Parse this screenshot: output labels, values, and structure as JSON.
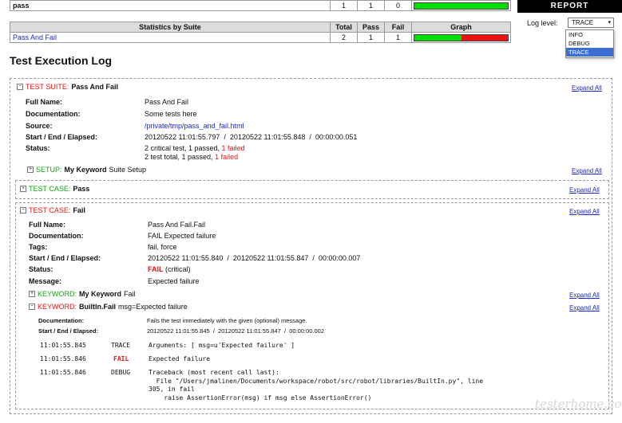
{
  "top_row": {
    "name": "pass",
    "total": "1",
    "pass": "1",
    "fail": "0",
    "pass_fraction": 1.0
  },
  "suite_stats": {
    "headers": [
      "Statistics by Suite",
      "Total",
      "Pass",
      "Fail",
      "Graph"
    ],
    "row": {
      "name": "Pass And Fail",
      "total": "2",
      "pass": "1",
      "fail": "1",
      "pass_fraction": 0.5
    }
  },
  "report": {
    "title": "REPORT",
    "log_level_label": "Log level:",
    "selected": "TRACE",
    "options": [
      "INFO",
      "DEBUG",
      "TRACE"
    ]
  },
  "log_title": "Test Execution Log",
  "suite": {
    "prefix": "TEST SUITE:",
    "name": "Pass And Fail",
    "expand": "Expand All",
    "labels": [
      "Full Name:",
      "Documentation:",
      "Source:",
      "Start / End / Elapsed:",
      "Status:"
    ],
    "full_name": "Pass And Fail",
    "documentation": "Some tests here",
    "source": "/private/tmp/pass_and_fail.html",
    "times": "20120522 11:01:55.797  /  20120522 11:01:55.848  /  00:00:00.051",
    "status1_prefix": "2 critical test, 1 passed, ",
    "status1_failed": "1 failed",
    "status2_prefix": "2 test total, 1 passed, ",
    "status2_failed": "1 failed",
    "setup": {
      "prefix": "SETUP:",
      "name": "My Keyword",
      "rest": "Suite Setup",
      "expand": "Expand All"
    }
  },
  "case_pass": {
    "prefix": "TEST CASE:",
    "name": "Pass",
    "expand": "Expand All"
  },
  "case_fail": {
    "prefix": "TEST CASE:",
    "name": "Fail",
    "expand": "Expand All",
    "labels": [
      "Full Name:",
      "Documentation:",
      "Tags:",
      "Start / End / Elapsed:",
      "Status:",
      "Message:"
    ],
    "full_name": "Pass And Fail.Fail",
    "documentation": "FAIL Expected failure",
    "tags": "fail, force",
    "times": "20120522 11:01:55.840  /  20120522 11:01:55.847  /  00:00:00.007",
    "status": "FAIL",
    "status_note": "(critical)",
    "message": "Expected failure",
    "kw1": {
      "prefix": "KEYWORD:",
      "name": "My Keyword",
      "rest": "Fail",
      "expand": "Expand All"
    },
    "kw2": {
      "prefix": "KEYWORD:",
      "name": "BuiltIn.Fail",
      "rest": "msg=Expected failure",
      "expand": "Expand All",
      "doc_label": "Documentation:",
      "doc": "Fails the test immediately with the given (optional) message.",
      "time_label": "Start / End / Elapsed:",
      "times": "20120522 11:01:55.845  /  20120522 11:01:55.847  /  00:00:00.002",
      "messages": [
        {
          "time": "11:01:55.845",
          "level": "TRACE",
          "text": "Arguments: [ msg=u'Expected failure' ]"
        },
        {
          "time": "11:01:55.846",
          "level": "FAIL",
          "text": "Expected failure"
        },
        {
          "time": "11:01:55.846",
          "level": "DEBUG",
          "text": "Traceback (most recent call last):\n  File \"/Users/jmalinen/Documents/workspace/robot/src/robot/libraries/BuiltIn.py\", line\n305, in fail\n    raise AssertionError(msg) if msg else AssertionError()"
        }
      ]
    }
  },
  "watermark": "testerhome.com",
  "colors": {
    "pass": "#00dd00",
    "fail": "#ee1111",
    "link": "#1a29cc",
    "fail_text": "#e01717",
    "kw_green": "#19a019"
  }
}
